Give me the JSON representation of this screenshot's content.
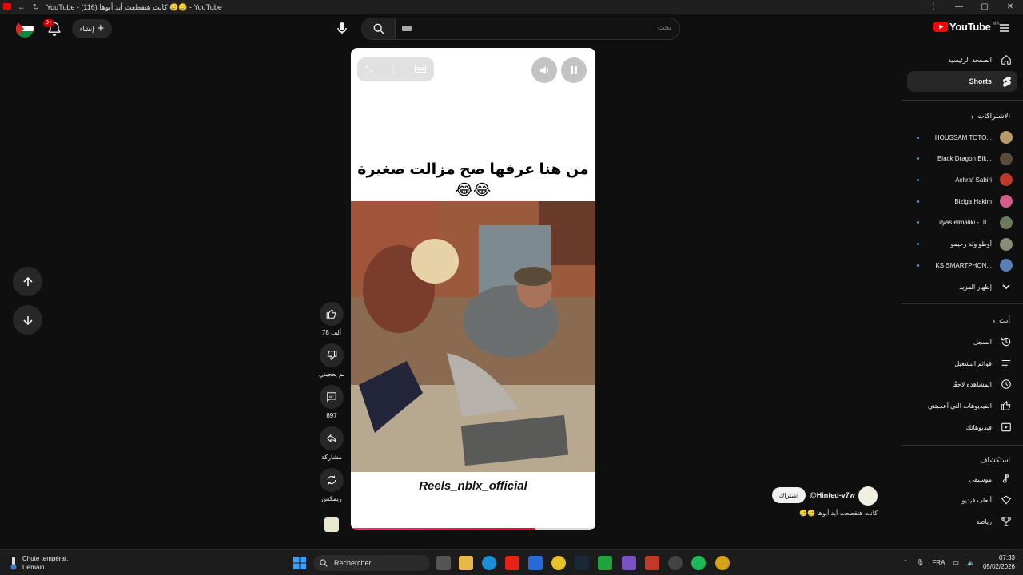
{
  "window": {
    "title": "YouTube - (116) كانت هتقطعت أيد أبوها 🥲🥲 - YouTube",
    "controls": [
      "—",
      "▢",
      "✕"
    ]
  },
  "header": {
    "search_placeholder": "بحث",
    "create_label": "إنشاء",
    "notification_count": "9+",
    "logo_text": "YouTube",
    "logo_region": "MA"
  },
  "video": {
    "caption_line1": "من هنا عرفها صح مزالت صغيرة",
    "caption_line2": "😂😂",
    "watermark": "Reels_nblx_official",
    "progress": 0.75
  },
  "actions": {
    "like_count": "78 ألف",
    "dislike_label": "لم يعجبني",
    "comments_count": "897",
    "share_label": "مشاركة",
    "remix_label": "ريمكس"
  },
  "channel": {
    "subscribe_label": "اشتراك",
    "handle": "@Hinted-v7w",
    "video_title": "كانت هتقطعت أيد أبوها 🥲🥲"
  },
  "sidebar": {
    "home": "الصفحة الرئيسية",
    "shorts": "Shorts",
    "subscriptions_header": "الاشتراكات",
    "subscriptions": [
      {
        "name": "HOUSSAM TOTO...",
        "color": "#b89a6a"
      },
      {
        "name": "Black Dragon Bik...",
        "color": "#5a4a3a"
      },
      {
        "name": "Achraf Sabiri",
        "color": "#c0392b"
      },
      {
        "name": "Biziga Hakim",
        "color": "#d35d8a"
      },
      {
        "name": "ilyas elmaliki - الـ...",
        "color": "#6a7a5a"
      },
      {
        "name": "أوطو ولد رحيمو",
        "color": "#8a8a7a"
      },
      {
        "name": "KS SMARTPHON...",
        "color": "#5a7fb5"
      }
    ],
    "show_more": "إظهار المزيد",
    "you_header": "أنت",
    "you_items": [
      "السجل",
      "قوائم التشغيل",
      "المشاهدة لاحقًا",
      "الفيديوهات التي أعجبتني",
      "فيديوهاتك"
    ],
    "explore_header": "استكشاف",
    "explore_items": [
      "موسيقى",
      "ألعاب فيديو",
      "رياضة"
    ]
  },
  "taskbar": {
    "weather_line1": "Chute températ.",
    "weather_line2": "Demain",
    "search_label": "Rechercher",
    "language": "FRA",
    "time": "07:33",
    "date": "05/02/2026"
  }
}
